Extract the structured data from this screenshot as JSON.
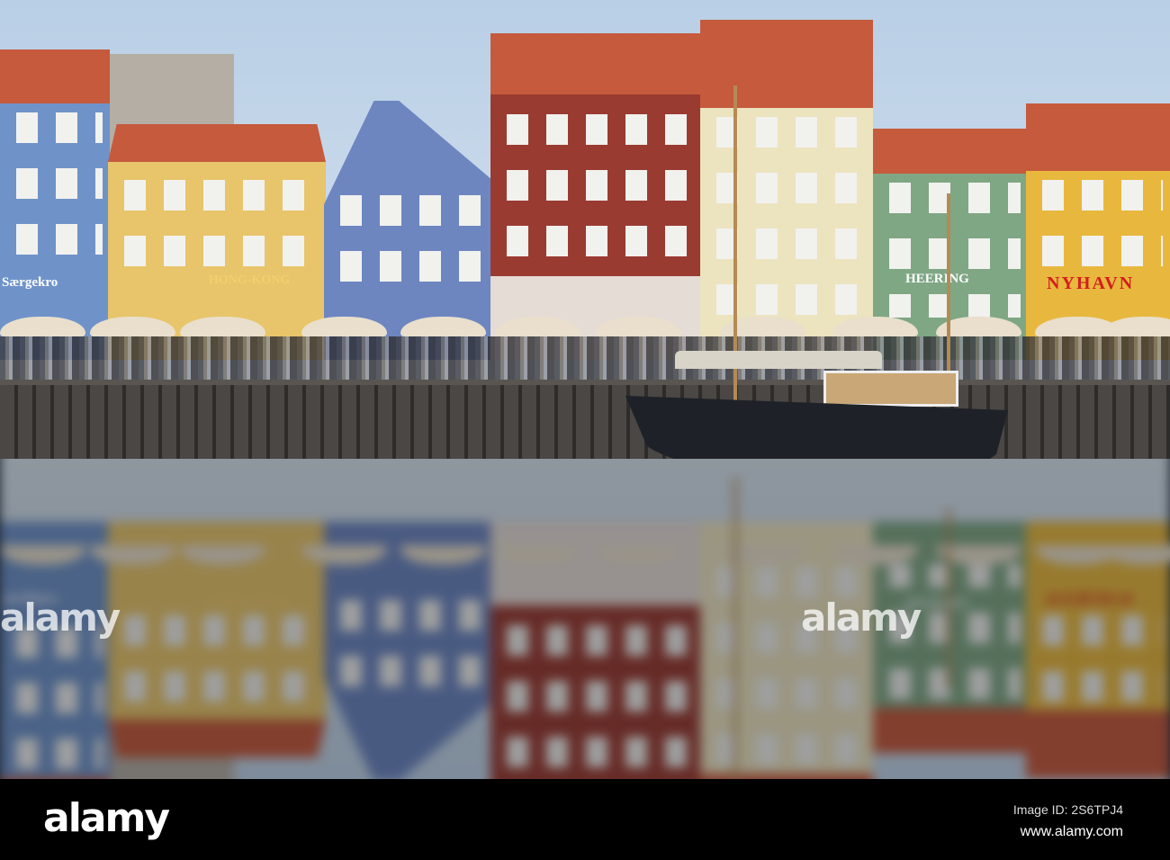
{
  "photo": {
    "subject": "Nyhavn",
    "signs": [
      "Særgekro",
      "HONG-KONG",
      "HEERING",
      "NYHAVN"
    ],
    "colors": {
      "sky": "#c9d9ea",
      "roof": "#c65a3c",
      "water": "#1c2430"
    }
  },
  "watermark": {
    "text": "alamy"
  },
  "footer": {
    "logo": "alamy",
    "image_id": "Image ID: 2S6TPJ4",
    "url": "www.alamy.com"
  }
}
